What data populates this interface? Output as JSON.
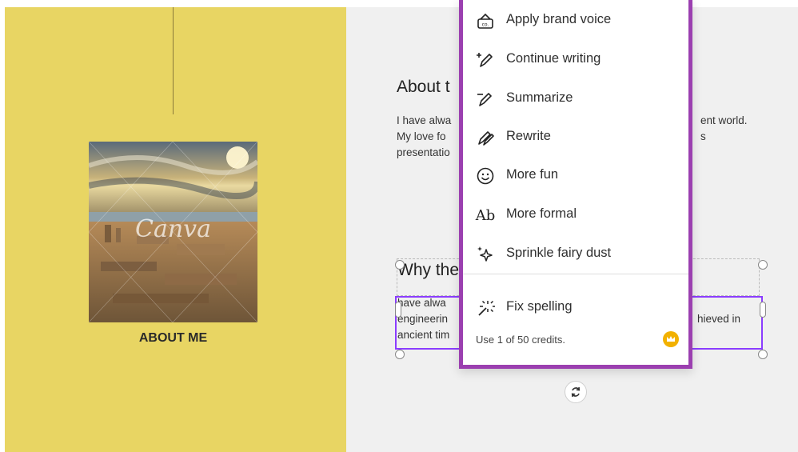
{
  "left_panel": {
    "photo_watermark": "Canva",
    "caption": "ABOUT ME"
  },
  "page": {
    "heading1": "About t",
    "para1_lines": [
      "I have alwa",
      "My love fo",
      "presentatio"
    ],
    "para1_right_lines": [
      "ent world.",
      "s"
    ],
    "heading2": "Why the",
    "para2_lines": [
      "have alwa",
      "engineerin",
      "ancient tim"
    ],
    "para2_right_lines": [
      "hieved in"
    ]
  },
  "ai_menu": {
    "items": [
      {
        "label": "Apply brand voice",
        "icon": "brand-voice-icon"
      },
      {
        "label": "Continue writing",
        "icon": "pen-plus-icon"
      },
      {
        "label": "Summarize",
        "icon": "pen-icon"
      },
      {
        "label": "Rewrite",
        "icon": "rewrite-pens-icon"
      },
      {
        "label": "More fun",
        "icon": "smiley-icon"
      },
      {
        "label": "More formal",
        "icon": "ab-formal-icon"
      },
      {
        "label": "Sprinkle fairy dust",
        "icon": "sparkle-icon"
      },
      {
        "label": "Fix spelling",
        "icon": "magic-wand-icon"
      }
    ],
    "credits_text": "Use 1 of 50 credits.",
    "formal_icon_text": "Ab"
  },
  "colors": {
    "left_panel": "#e8d563",
    "menu_border": "#9b3fb0",
    "selection": "#8b3dff",
    "crown": "#f2b100"
  }
}
